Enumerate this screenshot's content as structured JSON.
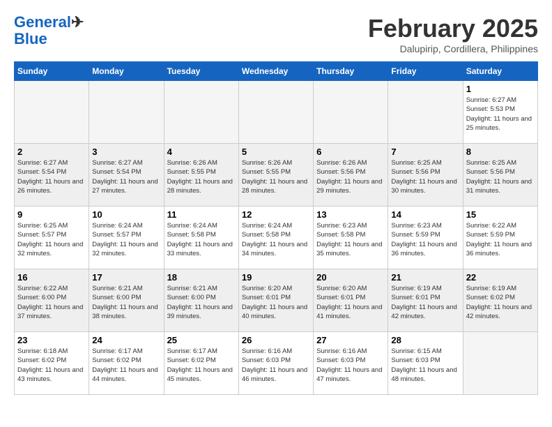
{
  "header": {
    "logo_line1": "General",
    "logo_line2": "Blue",
    "month": "February 2025",
    "location": "Dalupirip, Cordillera, Philippines"
  },
  "days_of_week": [
    "Sunday",
    "Monday",
    "Tuesday",
    "Wednesday",
    "Thursday",
    "Friday",
    "Saturday"
  ],
  "weeks": [
    [
      {
        "day": "",
        "info": ""
      },
      {
        "day": "",
        "info": ""
      },
      {
        "day": "",
        "info": ""
      },
      {
        "day": "",
        "info": ""
      },
      {
        "day": "",
        "info": ""
      },
      {
        "day": "",
        "info": ""
      },
      {
        "day": "1",
        "info": "Sunrise: 6:27 AM\nSunset: 5:53 PM\nDaylight: 11 hours and 25 minutes."
      }
    ],
    [
      {
        "day": "2",
        "info": "Sunrise: 6:27 AM\nSunset: 5:54 PM\nDaylight: 11 hours and 26 minutes."
      },
      {
        "day": "3",
        "info": "Sunrise: 6:27 AM\nSunset: 5:54 PM\nDaylight: 11 hours and 27 minutes."
      },
      {
        "day": "4",
        "info": "Sunrise: 6:26 AM\nSunset: 5:55 PM\nDaylight: 11 hours and 28 minutes."
      },
      {
        "day": "5",
        "info": "Sunrise: 6:26 AM\nSunset: 5:55 PM\nDaylight: 11 hours and 28 minutes."
      },
      {
        "day": "6",
        "info": "Sunrise: 6:26 AM\nSunset: 5:56 PM\nDaylight: 11 hours and 29 minutes."
      },
      {
        "day": "7",
        "info": "Sunrise: 6:25 AM\nSunset: 5:56 PM\nDaylight: 11 hours and 30 minutes."
      },
      {
        "day": "8",
        "info": "Sunrise: 6:25 AM\nSunset: 5:56 PM\nDaylight: 11 hours and 31 minutes."
      }
    ],
    [
      {
        "day": "9",
        "info": "Sunrise: 6:25 AM\nSunset: 5:57 PM\nDaylight: 11 hours and 32 minutes."
      },
      {
        "day": "10",
        "info": "Sunrise: 6:24 AM\nSunset: 5:57 PM\nDaylight: 11 hours and 32 minutes."
      },
      {
        "day": "11",
        "info": "Sunrise: 6:24 AM\nSunset: 5:58 PM\nDaylight: 11 hours and 33 minutes."
      },
      {
        "day": "12",
        "info": "Sunrise: 6:24 AM\nSunset: 5:58 PM\nDaylight: 11 hours and 34 minutes."
      },
      {
        "day": "13",
        "info": "Sunrise: 6:23 AM\nSunset: 5:58 PM\nDaylight: 11 hours and 35 minutes."
      },
      {
        "day": "14",
        "info": "Sunrise: 6:23 AM\nSunset: 5:59 PM\nDaylight: 11 hours and 36 minutes."
      },
      {
        "day": "15",
        "info": "Sunrise: 6:22 AM\nSunset: 5:59 PM\nDaylight: 11 hours and 36 minutes."
      }
    ],
    [
      {
        "day": "16",
        "info": "Sunrise: 6:22 AM\nSunset: 6:00 PM\nDaylight: 11 hours and 37 minutes."
      },
      {
        "day": "17",
        "info": "Sunrise: 6:21 AM\nSunset: 6:00 PM\nDaylight: 11 hours and 38 minutes."
      },
      {
        "day": "18",
        "info": "Sunrise: 6:21 AM\nSunset: 6:00 PM\nDaylight: 11 hours and 39 minutes."
      },
      {
        "day": "19",
        "info": "Sunrise: 6:20 AM\nSunset: 6:01 PM\nDaylight: 11 hours and 40 minutes."
      },
      {
        "day": "20",
        "info": "Sunrise: 6:20 AM\nSunset: 6:01 PM\nDaylight: 11 hours and 41 minutes."
      },
      {
        "day": "21",
        "info": "Sunrise: 6:19 AM\nSunset: 6:01 PM\nDaylight: 11 hours and 42 minutes."
      },
      {
        "day": "22",
        "info": "Sunrise: 6:19 AM\nSunset: 6:02 PM\nDaylight: 11 hours and 42 minutes."
      }
    ],
    [
      {
        "day": "23",
        "info": "Sunrise: 6:18 AM\nSunset: 6:02 PM\nDaylight: 11 hours and 43 minutes."
      },
      {
        "day": "24",
        "info": "Sunrise: 6:17 AM\nSunset: 6:02 PM\nDaylight: 11 hours and 44 minutes."
      },
      {
        "day": "25",
        "info": "Sunrise: 6:17 AM\nSunset: 6:02 PM\nDaylight: 11 hours and 45 minutes."
      },
      {
        "day": "26",
        "info": "Sunrise: 6:16 AM\nSunset: 6:03 PM\nDaylight: 11 hours and 46 minutes."
      },
      {
        "day": "27",
        "info": "Sunrise: 6:16 AM\nSunset: 6:03 PM\nDaylight: 11 hours and 47 minutes."
      },
      {
        "day": "28",
        "info": "Sunrise: 6:15 AM\nSunset: 6:03 PM\nDaylight: 11 hours and 48 minutes."
      },
      {
        "day": "",
        "info": ""
      }
    ]
  ]
}
